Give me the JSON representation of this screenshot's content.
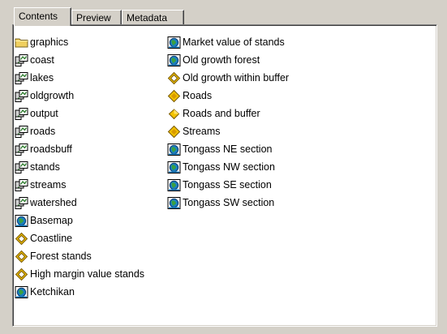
{
  "tabs": [
    {
      "label": "Contents",
      "active": true
    },
    {
      "label": "Preview",
      "active": false
    },
    {
      "label": "Metadata",
      "active": false
    }
  ],
  "contents": {
    "column1": [
      {
        "label": "graphics",
        "icon": "folder-icon"
      },
      {
        "label": "coast",
        "icon": "coverage-icon"
      },
      {
        "label": "lakes",
        "icon": "coverage-icon"
      },
      {
        "label": "oldgrowth",
        "icon": "coverage-icon"
      },
      {
        "label": "output",
        "icon": "coverage-icon"
      },
      {
        "label": "roads",
        "icon": "coverage-icon"
      },
      {
        "label": "roadsbuff",
        "icon": "coverage-icon"
      },
      {
        "label": "stands",
        "icon": "coverage-icon"
      },
      {
        "label": "streams",
        "icon": "coverage-icon"
      },
      {
        "label": "watershed",
        "icon": "coverage-icon"
      },
      {
        "label": "Basemap",
        "icon": "map-document-icon"
      },
      {
        "label": "Coastline",
        "icon": "layer-file-icon"
      },
      {
        "label": "Forest stands",
        "icon": "layer-file-icon"
      },
      {
        "label": "High margin value stands",
        "icon": "layer-file-icon"
      },
      {
        "label": "Ketchikan",
        "icon": "map-document-icon"
      }
    ],
    "column2": [
      {
        "label": "Market value of stands",
        "icon": "map-document-icon"
      },
      {
        "label": "Old growth forest",
        "icon": "map-document-icon"
      },
      {
        "label": "Old growth within buffer",
        "icon": "layer-file-icon"
      },
      {
        "label": "Roads",
        "icon": "layer-file-filled-icon"
      },
      {
        "label": "Roads and buffer",
        "icon": "group-layer-icon"
      },
      {
        "label": "Streams",
        "icon": "layer-file-filled-icon"
      },
      {
        "label": "Tongass NE section",
        "icon": "map-document-icon"
      },
      {
        "label": "Tongass NW section",
        "icon": "map-document-icon"
      },
      {
        "label": "Tongass SE section",
        "icon": "map-document-icon"
      },
      {
        "label": "Tongass SW section",
        "icon": "map-document-icon"
      }
    ]
  },
  "colors": {
    "folder": "#f0d060",
    "layer": "#f2c200",
    "globe": "#1a7fc0",
    "land": "#3aa040"
  }
}
